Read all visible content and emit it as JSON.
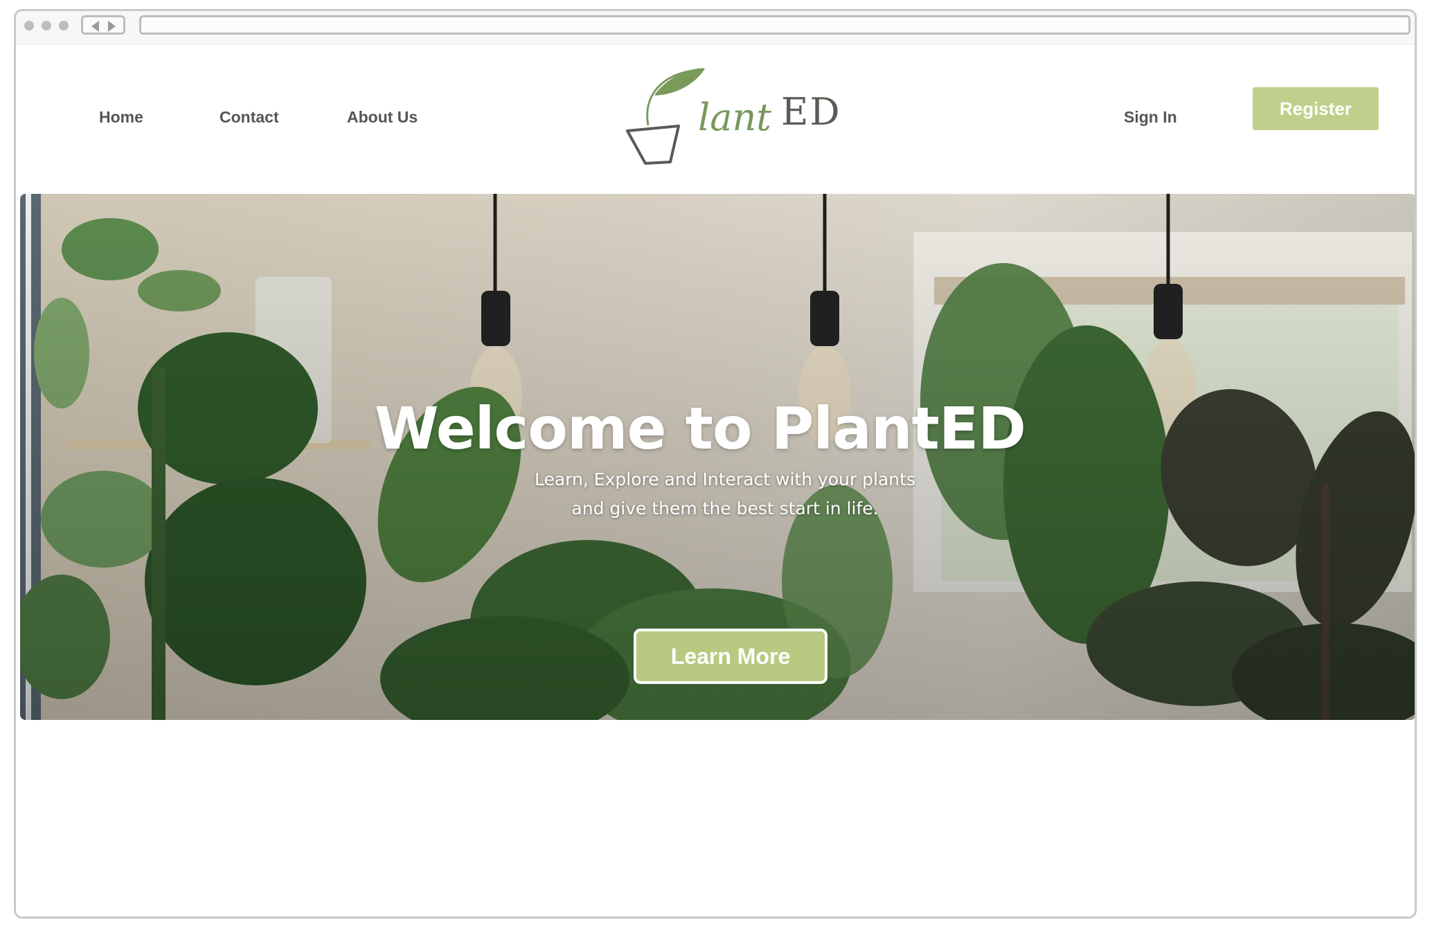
{
  "browser": {
    "address": ""
  },
  "nav": {
    "left_links": [
      "Home",
      "Contact",
      "About Us"
    ],
    "sign_in_label": "Sign In",
    "register_label": "Register"
  },
  "logo": {
    "text_script": "lant",
    "text_serif": "ED"
  },
  "hero": {
    "title": "Welcome to PlantED",
    "subtitle_line1": "Learn, Explore and Interact with your plants",
    "subtitle_line2": "and give them the best start in life.",
    "cta_label": "Learn More"
  },
  "colors": {
    "accent_green": "#bfd08c",
    "nav_text": "#555555",
    "logo_green": "#78985a",
    "logo_grey": "#5d5a56"
  },
  "icons": {
    "back": "chevron-left-icon",
    "forward": "chevron-right-icon"
  }
}
